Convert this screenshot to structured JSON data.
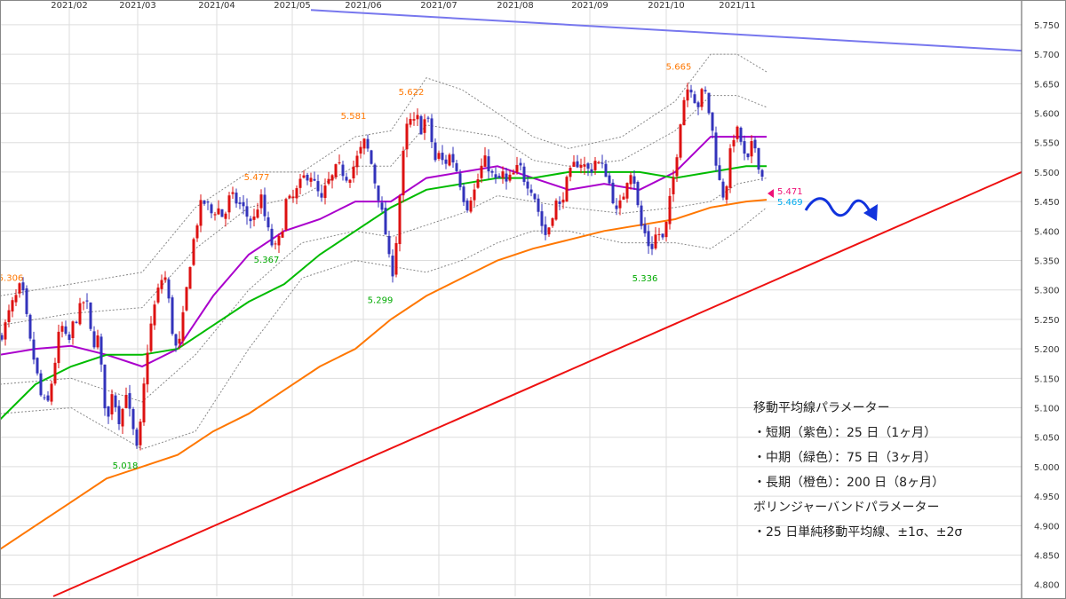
{
  "chart_data": {
    "type": "candlestick",
    "x_ticks": [
      "2021/02",
      "2021/03",
      "2021/04",
      "2021/05",
      "2021/06",
      "2021/07",
      "2021/08",
      "2021/09",
      "2021/10",
      "2021/11"
    ],
    "y_ticks": [
      "5.750",
      "5.700",
      "5.650",
      "5.600",
      "5.550",
      "5.500",
      "5.450",
      "5.400",
      "5.350",
      "5.300",
      "5.250",
      "5.200",
      "5.150",
      "5.100",
      "5.050",
      "5.000",
      "4.950",
      "4.900",
      "4.850",
      "4.800"
    ],
    "ylim": [
      4.78,
      5.78
    ],
    "grid": true,
    "price_path": [
      [
        0,
        5.22
      ],
      [
        6,
        5.24
      ],
      [
        12,
        5.27
      ],
      [
        19,
        5.29
      ],
      [
        24,
        5.31
      ],
      [
        28,
        5.27
      ],
      [
        34,
        5.21
      ],
      [
        40,
        5.17
      ],
      [
        46,
        5.12
      ],
      [
        53,
        5.1
      ],
      [
        60,
        5.16
      ],
      [
        66,
        5.22
      ],
      [
        71,
        5.24
      ],
      [
        76,
        5.2
      ],
      [
        82,
        5.24
      ],
      [
        88,
        5.26
      ],
      [
        94,
        5.28
      ],
      [
        99,
        5.27
      ],
      [
        104,
        5.2
      ],
      [
        109,
        5.23
      ],
      [
        113,
        5.18
      ],
      [
        117,
        5.12
      ],
      [
        121,
        5.07
      ],
      [
        126,
        5.13
      ],
      [
        131,
        5.1
      ],
      [
        136,
        5.07
      ],
      [
        141,
        5.14
      ],
      [
        146,
        5.09
      ],
      [
        151,
        5.05
      ],
      [
        155,
        5.02
      ],
      [
        160,
        5.1
      ],
      [
        165,
        5.19
      ],
      [
        170,
        5.24
      ],
      [
        175,
        5.28
      ],
      [
        180,
        5.31
      ],
      [
        185,
        5.33
      ],
      [
        190,
        5.28
      ],
      [
        195,
        5.22
      ],
      [
        200,
        5.19
      ],
      [
        205,
        5.24
      ],
      [
        210,
        5.3
      ],
      [
        215,
        5.36
      ],
      [
        220,
        5.4
      ],
      [
        225,
        5.44
      ],
      [
        231,
        5.45
      ],
      [
        238,
        5.43
      ],
      [
        245,
        5.44
      ],
      [
        252,
        5.42
      ],
      [
        259,
        5.46
      ],
      [
        266,
        5.45
      ],
      [
        273,
        5.44
      ],
      [
        280,
        5.42
      ],
      [
        286,
        5.42
      ],
      [
        293,
        5.46
      ],
      [
        300,
        5.41
      ],
      [
        305,
        5.38
      ],
      [
        310,
        5.37
      ],
      [
        316,
        5.39
      ],
      [
        322,
        5.45
      ],
      [
        328,
        5.45
      ],
      [
        335,
        5.47
      ],
      [
        342,
        5.49
      ],
      [
        349,
        5.5
      ],
      [
        356,
        5.47
      ],
      [
        362,
        5.45
      ],
      [
        368,
        5.48
      ],
      [
        374,
        5.49
      ],
      [
        380,
        5.51
      ],
      [
        386,
        5.5
      ],
      [
        392,
        5.49
      ],
      [
        398,
        5.51
      ],
      [
        404,
        5.53
      ],
      [
        410,
        5.55
      ],
      [
        416,
        5.53
      ],
      [
        421,
        5.49
      ],
      [
        426,
        5.46
      ],
      [
        431,
        5.42
      ],
      [
        436,
        5.38
      ],
      [
        440,
        5.32
      ],
      [
        443,
        5.34
      ],
      [
        447,
        5.4
      ],
      [
        451,
        5.48
      ],
      [
        456,
        5.56
      ],
      [
        460,
        5.59
      ],
      [
        465,
        5.58
      ],
      [
        470,
        5.59
      ],
      [
        475,
        5.57
      ],
      [
        480,
        5.6
      ],
      [
        485,
        5.56
      ],
      [
        490,
        5.52
      ],
      [
        495,
        5.53
      ],
      [
        500,
        5.51
      ],
      [
        505,
        5.53
      ],
      [
        510,
        5.52
      ],
      [
        515,
        5.5
      ],
      [
        520,
        5.47
      ],
      [
        525,
        5.44
      ],
      [
        530,
        5.46
      ],
      [
        535,
        5.47
      ],
      [
        540,
        5.5
      ],
      [
        545,
        5.52
      ],
      [
        550,
        5.51
      ],
      [
        555,
        5.49
      ],
      [
        560,
        5.48
      ],
      [
        565,
        5.5
      ],
      [
        570,
        5.48
      ],
      [
        575,
        5.49
      ],
      [
        580,
        5.5
      ],
      [
        585,
        5.51
      ],
      [
        590,
        5.49
      ],
      [
        595,
        5.48
      ],
      [
        600,
        5.47
      ],
      [
        605,
        5.44
      ],
      [
        610,
        5.41
      ],
      [
        615,
        5.39
      ],
      [
        620,
        5.42
      ],
      [
        625,
        5.45
      ],
      [
        630,
        5.44
      ],
      [
        635,
        5.47
      ],
      [
        640,
        5.49
      ],
      [
        646,
        5.51
      ],
      [
        652,
        5.52
      ],
      [
        658,
        5.51
      ],
      [
        664,
        5.5
      ],
      [
        670,
        5.52
      ],
      [
        676,
        5.51
      ],
      [
        682,
        5.5
      ],
      [
        688,
        5.47
      ],
      [
        694,
        5.43
      ],
      [
        700,
        5.45
      ],
      [
        706,
        5.49
      ],
      [
        712,
        5.51
      ],
      [
        717,
        5.45
      ],
      [
        721,
        5.41
      ],
      [
        725,
        5.4
      ],
      [
        729,
        5.38
      ],
      [
        733,
        5.37
      ],
      [
        737,
        5.39
      ],
      [
        741,
        5.4
      ],
      [
        745,
        5.38
      ],
      [
        749,
        5.4
      ],
      [
        753,
        5.44
      ],
      [
        757,
        5.48
      ],
      [
        761,
        5.52
      ],
      [
        765,
        5.58
      ],
      [
        769,
        5.62
      ],
      [
        773,
        5.64
      ],
      [
        777,
        5.65
      ],
      [
        781,
        5.63
      ],
      [
        785,
        5.61
      ],
      [
        789,
        5.63
      ],
      [
        793,
        5.64
      ],
      [
        797,
        5.61
      ],
      [
        801,
        5.58
      ],
      [
        805,
        5.53
      ],
      [
        809,
        5.49
      ],
      [
        813,
        5.46
      ],
      [
        817,
        5.47
      ],
      [
        821,
        5.52
      ],
      [
        825,
        5.56
      ],
      [
        829,
        5.57
      ],
      [
        833,
        5.56
      ],
      [
        837,
        5.53
      ],
      [
        841,
        5.51
      ],
      [
        845,
        5.54
      ],
      [
        849,
        5.55
      ],
      [
        853,
        5.52
      ],
      [
        857,
        5.5
      ],
      [
        861,
        5.469
      ]
    ],
    "series": [
      {
        "name": "短期（紫色）：25日",
        "color": "#aa00cc",
        "values": [
          [
            0,
            5.19
          ],
          [
            40,
            5.2
          ],
          [
            80,
            5.205
          ],
          [
            120,
            5.19
          ],
          [
            160,
            5.17
          ],
          [
            200,
            5.2
          ],
          [
            240,
            5.29
          ],
          [
            280,
            5.36
          ],
          [
            320,
            5.4
          ],
          [
            360,
            5.42
          ],
          [
            400,
            5.45
          ],
          [
            440,
            5.45
          ],
          [
            480,
            5.49
          ],
          [
            520,
            5.5
          ],
          [
            560,
            5.51
          ],
          [
            600,
            5.49
          ],
          [
            640,
            5.47
          ],
          [
            680,
            5.48
          ],
          [
            720,
            5.47
          ],
          [
            760,
            5.5
          ],
          [
            800,
            5.56
          ],
          [
            840,
            5.56
          ],
          [
            863,
            5.56
          ]
        ]
      },
      {
        "name": "中期（緑色）：75日",
        "color": "#00bb00",
        "values": [
          [
            0,
            5.08
          ],
          [
            40,
            5.14
          ],
          [
            80,
            5.17
          ],
          [
            120,
            5.19
          ],
          [
            160,
            5.19
          ],
          [
            200,
            5.2
          ],
          [
            240,
            5.24
          ],
          [
            280,
            5.28
          ],
          [
            320,
            5.31
          ],
          [
            360,
            5.36
          ],
          [
            400,
            5.4
          ],
          [
            440,
            5.44
          ],
          [
            480,
            5.47
          ],
          [
            520,
            5.48
          ],
          [
            560,
            5.49
          ],
          [
            600,
            5.49
          ],
          [
            640,
            5.5
          ],
          [
            680,
            5.5
          ],
          [
            720,
            5.5
          ],
          [
            760,
            5.49
          ],
          [
            800,
            5.5
          ],
          [
            840,
            5.51
          ],
          [
            863,
            5.51
          ]
        ]
      },
      {
        "name": "長期（橙色）：200日",
        "color": "#ff7700",
        "values": [
          [
            0,
            4.86
          ],
          [
            40,
            4.9
          ],
          [
            80,
            4.94
          ],
          [
            120,
            4.98
          ],
          [
            160,
            5.0
          ],
          [
            200,
            5.02
          ],
          [
            240,
            5.06
          ],
          [
            280,
            5.09
          ],
          [
            320,
            5.13
          ],
          [
            360,
            5.17
          ],
          [
            400,
            5.2
          ],
          [
            440,
            5.25
          ],
          [
            480,
            5.29
          ],
          [
            520,
            5.32
          ],
          [
            560,
            5.35
          ],
          [
            600,
            5.37
          ],
          [
            640,
            5.385
          ],
          [
            680,
            5.4
          ],
          [
            720,
            5.41
          ],
          [
            760,
            5.42
          ],
          [
            800,
            5.44
          ],
          [
            840,
            5.45
          ],
          [
            863,
            5.453
          ]
        ]
      }
    ],
    "bollinger": [
      [
        [
          0,
          5.29
        ],
        [
          80,
          5.31
        ],
        [
          160,
          5.33
        ],
        [
          220,
          5.44
        ],
        [
          280,
          5.5
        ],
        [
          340,
          5.5
        ],
        [
          400,
          5.56
        ],
        [
          440,
          5.57
        ],
        [
          480,
          5.66
        ],
        [
          520,
          5.64
        ],
        [
          560,
          5.6
        ],
        [
          600,
          5.56
        ],
        [
          640,
          5.54
        ],
        [
          700,
          5.56
        ],
        [
          760,
          5.62
        ],
        [
          800,
          5.7
        ],
        [
          830,
          5.7
        ],
        [
          863,
          5.67
        ]
      ],
      [
        [
          0,
          5.24
        ],
        [
          80,
          5.26
        ],
        [
          160,
          5.27
        ],
        [
          220,
          5.37
        ],
        [
          280,
          5.44
        ],
        [
          340,
          5.46
        ],
        [
          400,
          5.51
        ],
        [
          440,
          5.51
        ],
        [
          480,
          5.58
        ],
        [
          520,
          5.57
        ],
        [
          560,
          5.56
        ],
        [
          600,
          5.52
        ],
        [
          640,
          5.51
        ],
        [
          700,
          5.52
        ],
        [
          760,
          5.57
        ],
        [
          800,
          5.63
        ],
        [
          830,
          5.63
        ],
        [
          863,
          5.61
        ]
      ],
      [
        [
          0,
          5.14
        ],
        [
          80,
          5.15
        ],
        [
          160,
          5.11
        ],
        [
          220,
          5.19
        ],
        [
          280,
          5.3
        ],
        [
          340,
          5.38
        ],
        [
          400,
          5.4
        ],
        [
          440,
          5.39
        ],
        [
          480,
          5.41
        ],
        [
          520,
          5.43
        ],
        [
          560,
          5.46
        ],
        [
          600,
          5.45
        ],
        [
          640,
          5.44
        ],
        [
          700,
          5.43
        ],
        [
          760,
          5.44
        ],
        [
          800,
          5.45
        ],
        [
          830,
          5.48
        ],
        [
          863,
          5.49
        ]
      ],
      [
        [
          0,
          5.09
        ],
        [
          80,
          5.1
        ],
        [
          160,
          5.03
        ],
        [
          220,
          5.06
        ],
        [
          280,
          5.2
        ],
        [
          340,
          5.32
        ],
        [
          400,
          5.35
        ],
        [
          440,
          5.34
        ],
        [
          480,
          5.33
        ],
        [
          520,
          5.35
        ],
        [
          560,
          5.38
        ],
        [
          600,
          5.4
        ],
        [
          640,
          5.4
        ],
        [
          700,
          5.38
        ],
        [
          760,
          5.38
        ],
        [
          800,
          5.37
        ],
        [
          830,
          5.4
        ],
        [
          863,
          5.44
        ]
      ]
    ],
    "trendlines": [
      {
        "color": "#7777ee",
        "points": [
          [
            350,
            5.775
          ],
          [
            1150,
            5.706
          ]
        ]
      },
      {
        "color": "#ee1111",
        "points": [
          [
            60,
            4.78
          ],
          [
            1150,
            5.5
          ]
        ]
      }
    ],
    "annotations": [
      {
        "text": "5.306",
        "x": 12,
        "y": 5.306,
        "color": "#ff7700"
      },
      {
        "text": "5.018",
        "x": 141,
        "y": 5.018,
        "color": "#00aa00"
      },
      {
        "text": "5.477",
        "x": 289,
        "y": 5.477,
        "color": "#ff7700"
      },
      {
        "text": "5.367",
        "x": 300,
        "y": 5.367,
        "color": "#00aa00"
      },
      {
        "text": "5.581",
        "x": 398,
        "y": 5.581,
        "color": "#ff7700"
      },
      {
        "text": "5.299",
        "x": 428,
        "y": 5.299,
        "color": "#00aa00"
      },
      {
        "text": "5.622",
        "x": 463,
        "y": 5.622,
        "color": "#ff7700"
      },
      {
        "text": "5.336",
        "x": 726,
        "y": 5.336,
        "color": "#00aa00"
      },
      {
        "text": "5.665",
        "x": 764,
        "y": 5.665,
        "color": "#ff7700"
      }
    ],
    "price_labels": [
      {
        "text": "5.471",
        "y": 5.471,
        "color": "#ee1177"
      },
      {
        "text": "5.469",
        "y": 5.469,
        "color": "#00aaee"
      }
    ]
  },
  "legend": {
    "title": "移動平均線パラメーター",
    "short": "・短期（紫色）：25 日（1ヶ月）",
    "mid": "・中期（緑色）：75 日（3ヶ月）",
    "long": "・長期（橙色）：200 日（8ヶ月）",
    "bb_title": "ボリンジャーバンドパラメーター",
    "bb": "・25 日単純移動平均線、±1σ、±2σ"
  },
  "colors": {
    "up_candle": "#dd1111",
    "down_candle": "#3333bb",
    "forecast_arrow": "#1133dd",
    "grid": "#dddddd"
  }
}
